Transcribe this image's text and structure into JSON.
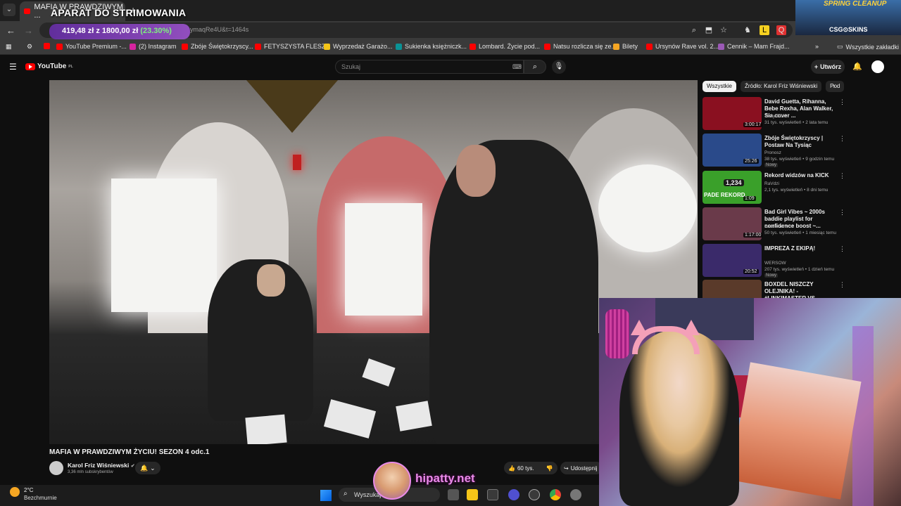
{
  "browser": {
    "tab_title": "MAFIA W PRAWDZIWYM ...",
    "url_fragment": "ymaqRe4U&t=1464s",
    "bookmarks": [
      {
        "label": "YouTube Premium -...",
        "color": "#ff0000"
      },
      {
        "label": "(2) Instagram",
        "color": "#d6249f"
      },
      {
        "label": "Zbóje Świętokrzyscy...",
        "color": "#ff0000"
      },
      {
        "label": "FETYSZYSTA FLESZ...",
        "color": "#ff0000"
      },
      {
        "label": "Wyprzedaż Garażo...",
        "color": "#f5c518"
      },
      {
        "label": "Sukienka księżniczk...",
        "color": "#0a9396"
      },
      {
        "label": "Lombard. Życie pod...",
        "color": "#ff0000"
      },
      {
        "label": "Natsu rozlicza się ze...",
        "color": "#ff0000"
      },
      {
        "label": "Bilety",
        "color": "#f5a623"
      },
      {
        "label": "Ursynów Rave vol. 2...",
        "color": "#ff0000"
      },
      {
        "label": "Cennik – Mam Frajd...",
        "color": "#9b59b6"
      }
    ],
    "all_bookmarks_label": "Wszystkie zakładki"
  },
  "stream_overlay": {
    "title": "APARAT DO STRIMOWANIA",
    "donation_current": "419,48 zł",
    "donation_sep": "z",
    "donation_goal": "1800,00 zł",
    "donation_pct": "(23.30%)",
    "banner_top": "SPRING CLEANUP",
    "banner_bottom": "CSG⊙SKINS",
    "site_watermark": "hipatty.net"
  },
  "youtube": {
    "logo_text": "YouTube",
    "logo_region": "PL",
    "search_placeholder": "Szukaj",
    "create_label": "Utwórz",
    "video_title": "MAFIA W PRAWDZIWYM ŻYCIU! SEZON 4 odc.1",
    "channel_name": "Karol Friz Wiśniewski",
    "channel_subs": "3,36 mln subskrybentów",
    "likes": "60 tys.",
    "share_label": "Udostępnij",
    "chips": [
      "Wszystkie",
      "Źródło: Karol Friz Wiśniewski",
      "Pod"
    ],
    "recommendations": [
      {
        "title": "David Guetta, Rihanna, Bebe Rexha, Alan Walker, Sia cover ...",
        "channel": "Tasty EDM",
        "meta": "31 tys. wyświetleń • 2 lata temu",
        "duration": "3:00:17",
        "new": "",
        "thumb": "#8a1020"
      },
      {
        "title": "Zbóje Świętokrzyscy | Postaw Na Tysiąc",
        "channel": "Pronosz",
        "meta": "38 tys. wyświetleń • 9 godzin temu",
        "duration": "25:26",
        "new": "Nowy",
        "thumb": "#2a4a8a"
      },
      {
        "title": "Rekord widzów na KICK",
        "channel": "RaVdzi",
        "meta": "2,1 tys. wyświetleń • 8 dni temu",
        "duration": "1:09",
        "new": "",
        "thumb": "#3aa02a"
      },
      {
        "title": "Bad Girl Vibes ~ 2000s baddie playlist for confidence boost ~...",
        "channel": "baddie femme",
        "meta": "50 tys. wyświetleń • 1 miesiąc temu",
        "duration": "1:17:00",
        "new": "",
        "thumb": "#6a3a4a"
      },
      {
        "title": "IMPREZA Z EKIPĄ!",
        "channel": "WERSOW",
        "meta": "207 tys. wyświetleń • 1 dzień temu",
        "duration": "20:52",
        "new": "Nowy",
        "thumb": "#3a2a6a"
      },
      {
        "title": "BOXDEL NISZCZY OLEJNIKA! - #LINKIMASTER VS BADUREK* ...",
        "channel": "",
        "meta": "",
        "duration": "",
        "new": "",
        "thumb": "#5a3a2a"
      }
    ],
    "thumb_badge_kick": "1,234",
    "thumb_badge_pade": "PADE REKORD"
  },
  "taskbar": {
    "temp": "2°C",
    "weather": "Bezchmurnie",
    "search_placeholder": "Wyszukaj"
  }
}
